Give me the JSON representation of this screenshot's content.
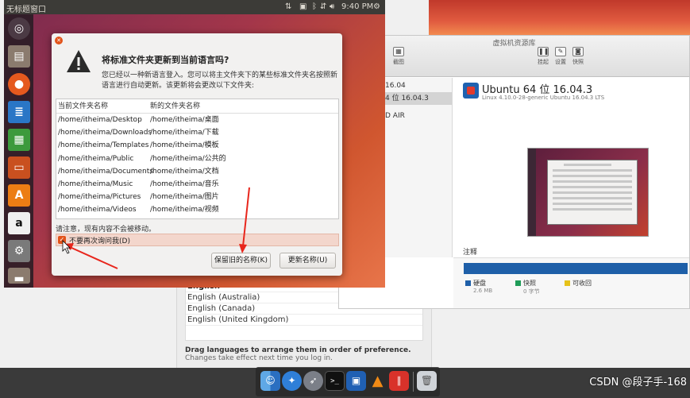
{
  "ubuntu_topbar": {
    "window_title": "无标题窗口",
    "time": "9:40 PM",
    "tray_icons": [
      "sort-icon",
      "input-method-icon",
      "bluetooth-icon",
      "network-icon",
      "volume-icon",
      "gear-icon"
    ]
  },
  "launcher": {
    "items": [
      "ubuntu-dash-icon",
      "files-icon",
      "firefox-icon",
      "writer-icon",
      "calc-icon",
      "impress-icon",
      "software-center-icon",
      "amazon-icon",
      "settings-icon",
      "drawer-icon"
    ]
  },
  "dialog": {
    "title": "将标准文件夹更新到当前语言吗?",
    "body": "您已经以一种新语言登入。您可以将主文件夹下的某些标准文件夹名按照新语言进行自动更新。该更新将会更改以下文件夹:",
    "columns": [
      "当前文件夹名称",
      "新的文件夹名称"
    ],
    "rows": [
      {
        "current": "/home/itheima/Desktop",
        "new": "/home/itheima/桌面"
      },
      {
        "current": "/home/itheima/Downloads",
        "new": "/home/itheima/下载"
      },
      {
        "current": "/home/itheima/Templates",
        "new": "/home/itheima/模板"
      },
      {
        "current": "/home/itheima/Public",
        "new": "/home/itheima/公共的"
      },
      {
        "current": "/home/itheima/Documents",
        "new": "/home/itheima/文档"
      },
      {
        "current": "/home/itheima/Music",
        "new": "/home/itheima/音乐"
      },
      {
        "current": "/home/itheima/Pictures",
        "new": "/home/itheima/图片"
      },
      {
        "current": "/home/itheima/Videos",
        "new": "/home/itheima/视频"
      }
    ],
    "note": "请注意，现有内容不会被移动。",
    "checkbox_label": "不要再次询问我(D)",
    "checkbox_checked": true,
    "keep_button": "保留旧的名称(K)",
    "update_button": "更新名称(U)",
    "accent_color": "#e2531a"
  },
  "vbox": {
    "window_title": "虚拟机资源库",
    "toolbar": {
      "screenshot": "截图",
      "snapshot": "挂起",
      "settings": "设置",
      "quick": "快照"
    },
    "vm_list": [
      "16.04",
      "4 位 16.04.3",
      "D AIR"
    ],
    "vm_name": "Ubuntu 64 位 16.04.3",
    "vm_sub": "Linux 4.10.0-28-generic Ubuntu 16.04.3 LTS",
    "notes_label": "注释",
    "storage": [
      {
        "label": "硬盘",
        "value": "2.6 MB",
        "color": "#1e5fa8"
      },
      {
        "label": "快照",
        "value": "0 字节",
        "color": "#1f9c58"
      },
      {
        "label": "可收回",
        "value": "",
        "color": "#e6c21a"
      }
    ]
  },
  "lang_prefs": {
    "languages": [
      "English",
      "English (Australia)",
      "English (Canada)",
      "English (United Kingdom)"
    ],
    "help_bold": "Drag languages to arrange them in order of preference.",
    "help_sub": "Changes take effect next time you log in."
  },
  "dock": {
    "items": [
      "finder-icon",
      "safari-icon",
      "launchpad-icon",
      "terminal-icon",
      "virtualbox-icon",
      "vlc-icon",
      "parallels-icon",
      "trash-icon"
    ]
  },
  "watermark": "CSDN @段子手-168"
}
